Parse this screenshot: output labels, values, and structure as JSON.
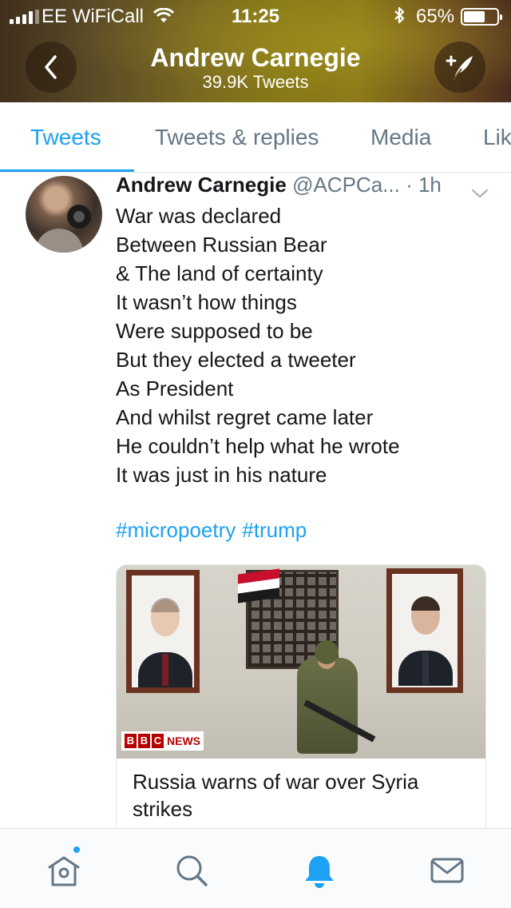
{
  "status_bar": {
    "carrier": "EE WiFiCall",
    "time": "11:25",
    "battery_percent": "65%",
    "battery_level": 0.65,
    "icons": [
      "signal-icon",
      "wifi-icon",
      "bluetooth-icon",
      "battery-icon"
    ]
  },
  "header": {
    "title": "Andrew Carnegie",
    "subtitle": "39.9K Tweets",
    "back_icon": "chevron-left-icon",
    "compose_icon": "compose-feather-icon",
    "accent": "#877a16"
  },
  "tabs": [
    {
      "label": "Tweets",
      "active": true
    },
    {
      "label": "Tweets & replies",
      "active": false
    },
    {
      "label": "Media",
      "active": false
    },
    {
      "label": "Lik",
      "active": false
    }
  ],
  "tweet": {
    "author": "Andrew Carnegie",
    "handle": "@ACPCa...",
    "time": "· 1h",
    "lines": [
      "War was declared",
      "Between Russian Bear",
      "& The land of certainty",
      "It wasn’t how things",
      "Were supposed to be",
      "But they elected a tweeter",
      "As President",
      "And whilst regret came later",
      "He couldn’t help what he wrote",
      "It was just in his nature"
    ],
    "hashtags": [
      "#micropoetry",
      "#trump"
    ],
    "card": {
      "logo_letters": [
        "B",
        "B",
        "C"
      ],
      "logo_news": "NEWS",
      "title": "Russia warns of war over Syria strikes"
    }
  },
  "bottom_nav": {
    "items": [
      "home-icon",
      "search-icon",
      "notifications-bell-icon",
      "messages-envelope-icon"
    ],
    "active": "notifications-bell-icon",
    "home_has_badge": true
  },
  "colors": {
    "link_blue": "#1da1f2",
    "text_gray": "#657786",
    "text_dark": "#14171a",
    "bbc_red": "#b80000"
  }
}
